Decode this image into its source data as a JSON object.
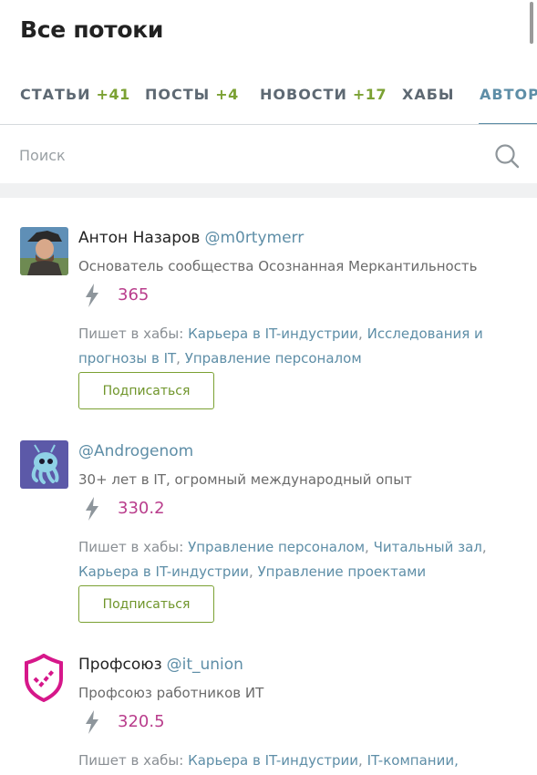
{
  "header": {
    "title": "Все потоки"
  },
  "tabs": [
    {
      "label": "СТАТЬИ",
      "count": "+41"
    },
    {
      "label": "ПОСТЫ",
      "count": "+4"
    },
    {
      "label": "НОВОСТИ",
      "count": "+17"
    },
    {
      "label": "ХАБЫ",
      "count": ""
    },
    {
      "label": "АВТОРЫ",
      "count": ""
    }
  ],
  "active_tab": "АВТОРЫ",
  "search": {
    "placeholder": "Поиск",
    "value": ""
  },
  "authors": [
    {
      "name": "Антон Назаров",
      "nick": "@m0rtymerr",
      "spec": "Основатель сообщества Осознанная Меркантильность",
      "karma": "365",
      "hubs_label": "Пишет в хабы:",
      "hubs": [
        "Карьера в IT-индустрии",
        "Исследования и прогнозы в IT",
        "Управление персоналом"
      ],
      "subscribe": "Подписаться"
    },
    {
      "name": "",
      "nick": "@Androgenom",
      "spec": "30+ лет в IT, огромный международный опыт",
      "karma": "330.2",
      "hubs_label": "Пишет в хабы:",
      "hubs": [
        "Управление персоналом",
        "Читальный зал",
        "Карьера в IT-индустрии",
        "Управление проектами"
      ],
      "subscribe": "Подписаться"
    },
    {
      "name": "Профсоюз",
      "nick": "@it_union",
      "spec": "Профсоюз работников ИТ",
      "karma": "320.5",
      "hubs_label": "Пишет в хабы:",
      "hubs": [
        "Карьера в IT-индустрии",
        "IT-компании,"
      ],
      "subscribe": ""
    }
  ],
  "colors": {
    "accent": "#5e8ea7",
    "count_green": "#7ba133",
    "karma": "#b93d8c",
    "union_brand": "#d6178a"
  },
  "icons": {
    "search": "search-icon",
    "karma": "lightning-icon",
    "avatar_3": "union-shield-icon"
  }
}
